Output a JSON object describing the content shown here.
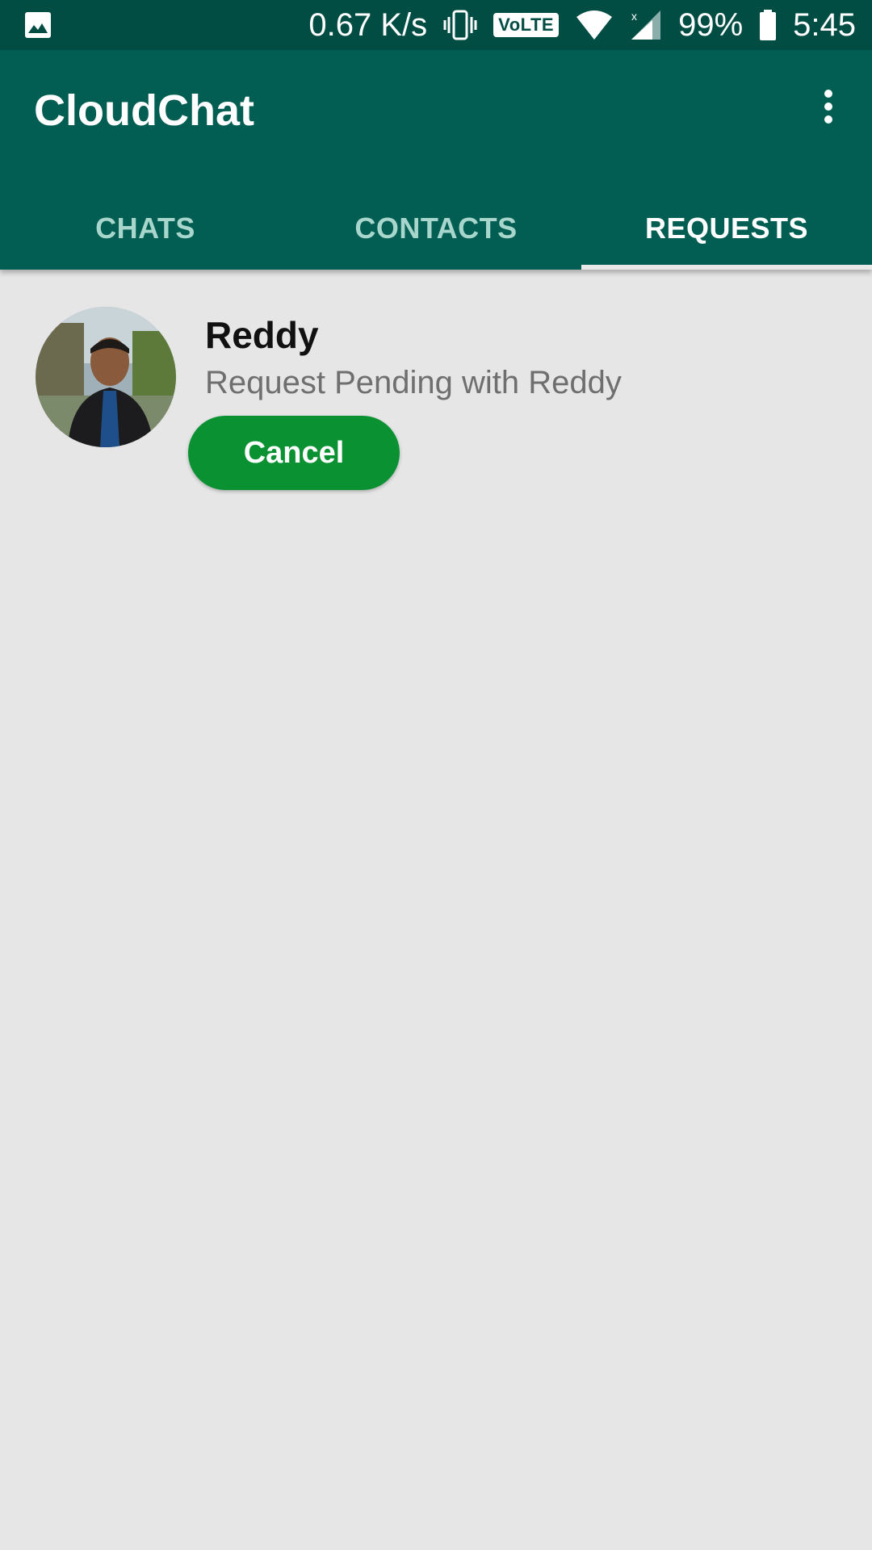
{
  "status_bar": {
    "network_speed": "0.67 K/s",
    "volte_label": "VoLTE",
    "battery": "99%",
    "time": "5:45"
  },
  "app": {
    "title": "CloudChat"
  },
  "tabs": [
    {
      "label": "CHATS",
      "active": false
    },
    {
      "label": "CONTACTS",
      "active": false
    },
    {
      "label": "REQUESTS",
      "active": true
    }
  ],
  "requests": [
    {
      "name": "Reddy",
      "status": "Request Pending with Reddy",
      "action_label": "Cancel"
    }
  ],
  "colors": {
    "status_bar": "#014d44",
    "app_bar": "#025e52",
    "background": "#e6e6e6",
    "cancel_button": "#0a9232",
    "inactive_tab": "#a9d6cc"
  }
}
